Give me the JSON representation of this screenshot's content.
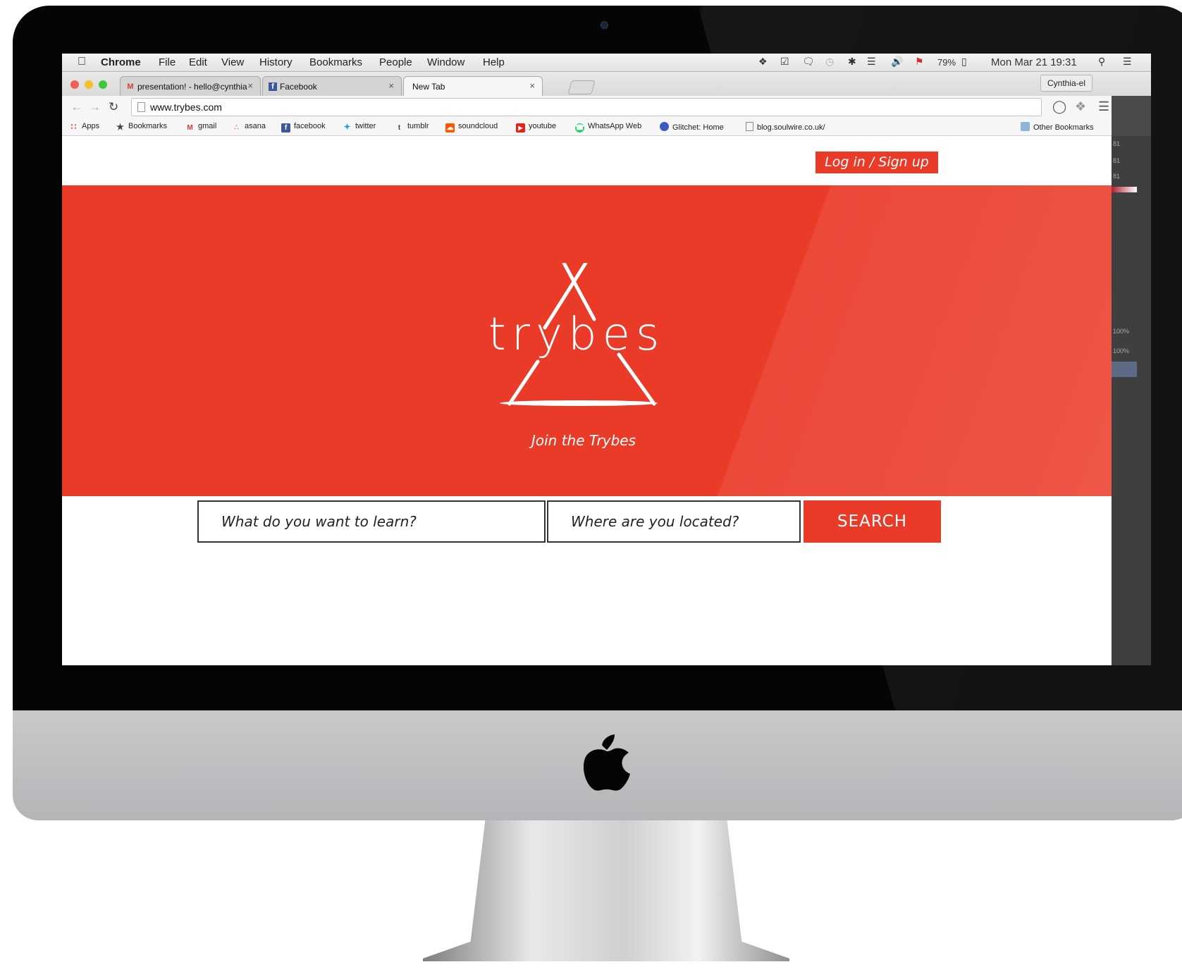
{
  "menubar": {
    "app": "Chrome",
    "items": [
      "File",
      "Edit",
      "View",
      "History",
      "Bookmarks",
      "People",
      "Window",
      "Help"
    ],
    "battery": "79%",
    "clock": "Mon Mar 21 19:31"
  },
  "tabs": [
    {
      "label": "presentation! - hello@cynthia",
      "favicon": "gmail-icon",
      "close": "×"
    },
    {
      "label": "Facebook",
      "favicon": "facebook-icon",
      "close": "×"
    },
    {
      "label": "New Tab",
      "favicon": "",
      "close": "×"
    }
  ],
  "profile": "Cynthia-el",
  "toolbar": {
    "url": "www.trybes.com"
  },
  "bookmarks": [
    {
      "label": "Apps",
      "icon": "apps-grid-icon"
    },
    {
      "label": "Bookmarks",
      "icon": "star-icon"
    },
    {
      "label": "gmail",
      "icon": "gmail-icon"
    },
    {
      "label": "asana",
      "icon": "asana-icon"
    },
    {
      "label": "facebook",
      "icon": "facebook-icon"
    },
    {
      "label": "twitter",
      "icon": "twitter-icon"
    },
    {
      "label": "tumblr",
      "icon": "tumblr-icon"
    },
    {
      "label": "soundcloud",
      "icon": "soundcloud-icon"
    },
    {
      "label": "youtube",
      "icon": "youtube-icon"
    },
    {
      "label": "WhatsApp Web",
      "icon": "whatsapp-icon"
    },
    {
      "label": "Glitchet: Home",
      "icon": "glitchet-icon"
    },
    {
      "label": "blog.soulwire.co.uk/",
      "icon": "page-icon"
    }
  ],
  "other_bookmarks": "Other Bookmarks",
  "site": {
    "login_label": "Log in / Sign up",
    "logo_text": "trybes",
    "tagline": "Join the Trybes",
    "search": {
      "what_placeholder": "What do you want to learn?",
      "where_placeholder": "Where are you located?",
      "button_label": "SEARCH"
    }
  },
  "side_panel": {
    "labels": [
      "81",
      "81",
      "81",
      "100%",
      "100%"
    ]
  },
  "colors": {
    "brand_red": "#ea3a28",
    "bezel": "#050505",
    "chin": "#c0c0c2"
  }
}
